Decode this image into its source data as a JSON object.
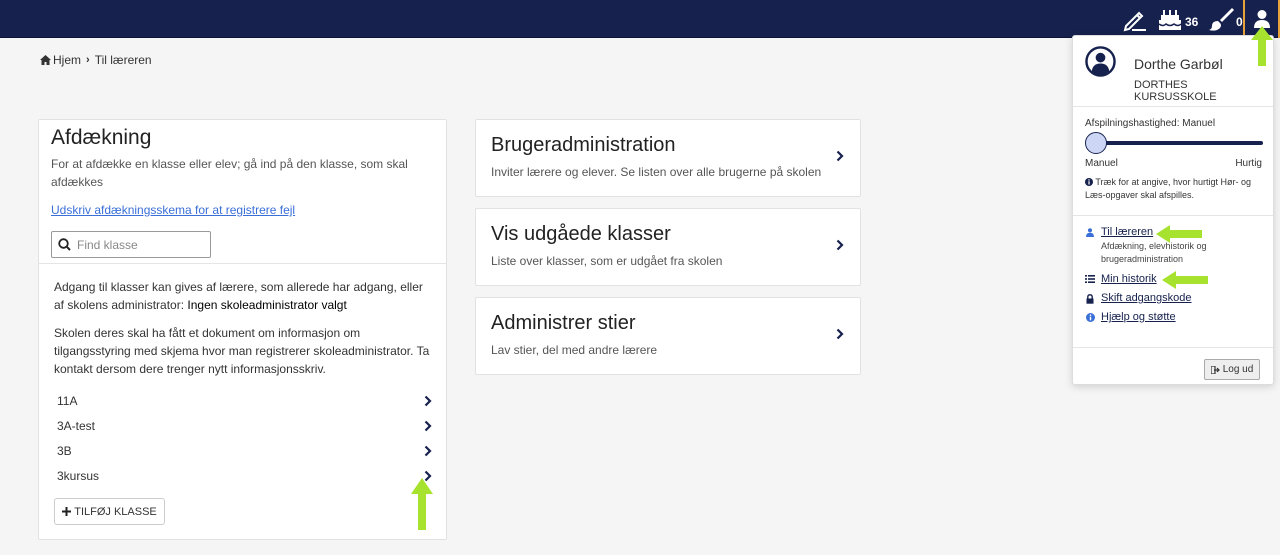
{
  "topbar": {
    "bg_color": "#16214d",
    "icons": [
      "pencil-icon",
      "cake-icon",
      "brush-icon",
      "user-icon"
    ],
    "cake_count": "36",
    "brush_count": "0"
  },
  "breadcrumb": {
    "home": "Hjem",
    "current": "Til læreren"
  },
  "afdaekning": {
    "title": "Afdækning",
    "description": "For at afdække en klasse eller elev; gå ind på den klasse, som skal afdækkes",
    "print_link": "Udskriv afdækningsskema for at registrere fejl",
    "search_placeholder": "Find klasse",
    "access_text": "Adgang til klasser kan gives af lærere, som allerede har adgang, eller af skolens administrator: ",
    "access_admin": "Ingen skoleadministrator valgt",
    "info_text": "Skolen deres skal ha fått et dokument om informasjon om tilgangsstyring med skjema hvor man registrerer skoleadministrator. Ta kontakt dersom dere trenger nytt informasjonsskriv.",
    "classes": [
      "11A",
      "3A-test",
      "3B",
      "3kursus"
    ],
    "add_button": "TILFØJ KLASSE"
  },
  "cards": [
    {
      "title": "Brugeradministration",
      "subtitle": "Inviter lærere og elever. Se listen over alle brugerne på skolen"
    },
    {
      "title": "Vis udgåede klasser",
      "subtitle": "Liste over klasser, som er udgået fra skolen"
    },
    {
      "title": "Administrer stier",
      "subtitle": "Lav stier, del med andre lærere"
    }
  ],
  "user_menu": {
    "name": "Dorthe Garbøl",
    "school": "DORTHES KURSUSSKOLE",
    "speed_label": "Afspilningshastighed: Manuel",
    "speed_value": 0,
    "slider_min_label": "Manuel",
    "slider_max_label": "Hurtig",
    "hint": "Træk for at angive, hvor hurtigt Hør- og Læs-opgaver skal afspilles.",
    "items": [
      {
        "label": "Til læreren",
        "sub": "Afdækning, elevhistorik og brugeradministration",
        "icon": "user-icon"
      },
      {
        "label": "Min historik",
        "icon": "list-icon"
      },
      {
        "label": "Skift adgangskode",
        "icon": "lock-icon"
      },
      {
        "label": "Hjælp og støtte",
        "icon": "info-icon"
      }
    ],
    "logout": "Log ud"
  },
  "annotation_color": "#a6e22e"
}
